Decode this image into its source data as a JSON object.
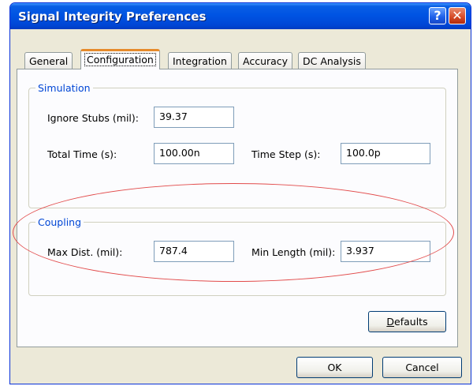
{
  "window": {
    "title": "Signal Integrity Preferences",
    "help_label": "?",
    "close_label": "✕"
  },
  "tabs": [
    {
      "label": "General",
      "active": false
    },
    {
      "label": "Configuration",
      "active": true
    },
    {
      "label": "Integration",
      "active": false
    },
    {
      "label": "Accuracy",
      "active": false
    },
    {
      "label": "DC Analysis",
      "active": false
    }
  ],
  "simulation": {
    "legend": "Simulation",
    "ignore_stubs_label": "Ignore Stubs (mil):",
    "ignore_stubs_value": "39.37",
    "total_time_label": "Total Time (s):",
    "total_time_value": "100.00n",
    "time_step_label": "Time Step (s):",
    "time_step_value": "100.0p"
  },
  "coupling": {
    "legend": "Coupling",
    "max_dist_label": "Max Dist. (mil):",
    "max_dist_value": "787.4",
    "min_length_label": "Min Length (mil):",
    "min_length_value": "3.937"
  },
  "buttons": {
    "defaults_accel": "D",
    "defaults_rest": "efaults",
    "ok": "OK",
    "cancel": "Cancel"
  },
  "colors": {
    "titlebar": "#0054e3",
    "group_legend": "#0046d5",
    "annotation": "#e24b4b"
  }
}
